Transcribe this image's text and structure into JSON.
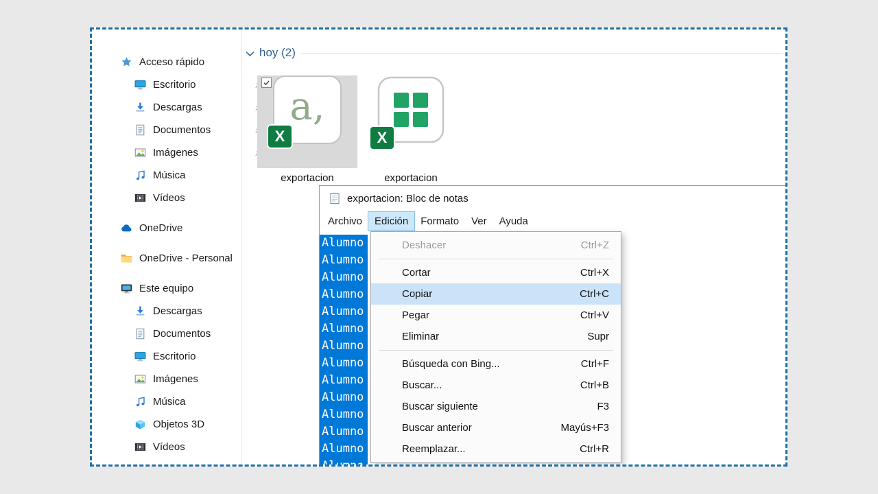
{
  "colors": {
    "marquee_dash": "#1d6fa3",
    "text_selection": "#0078d7",
    "menu_highlight": "#cbe3f9",
    "excel_green": "#107c41"
  },
  "explorer": {
    "group_header": "hoy (2)",
    "sidebar": {
      "sections": [
        {
          "label": "Acceso rápido",
          "icon": "quick-access-star-icon",
          "children": [
            {
              "label": "Escritorio",
              "icon": "desktop-icon",
              "pinned": true
            },
            {
              "label": "Descargas",
              "icon": "downloads-icon",
              "pinned": true
            },
            {
              "label": "Documentos",
              "icon": "documents-icon",
              "pinned": true
            },
            {
              "label": "Imágenes",
              "icon": "pictures-icon",
              "pinned": true
            },
            {
              "label": "Música",
              "icon": "music-icon",
              "pinned": false
            },
            {
              "label": "Vídeos",
              "icon": "videos-icon",
              "pinned": false
            }
          ]
        },
        {
          "label": "OneDrive",
          "icon": "onedrive-cloud-icon",
          "children": []
        },
        {
          "label": "OneDrive - Personal",
          "icon": "folder-icon",
          "children": []
        },
        {
          "label": "Este equipo",
          "icon": "this-pc-icon",
          "children": [
            {
              "label": "Descargas",
              "icon": "downloads-icon",
              "pinned": false
            },
            {
              "label": "Documentos",
              "icon": "documents-icon",
              "pinned": false
            },
            {
              "label": "Escritorio",
              "icon": "desktop-icon",
              "pinned": false
            },
            {
              "label": "Imágenes",
              "icon": "pictures-icon",
              "pinned": false
            },
            {
              "label": "Música",
              "icon": "music-icon",
              "pinned": false
            },
            {
              "label": "Objetos 3D",
              "icon": "3d-objects-icon",
              "pinned": false
            },
            {
              "label": "Vídeos",
              "icon": "videos-icon",
              "pinned": false
            }
          ]
        }
      ]
    },
    "files": [
      {
        "name": "exportacion",
        "selected": true,
        "checked": true,
        "icon": "csv-file-icon",
        "icon_glyph": "a,",
        "badge_glyph": "X"
      },
      {
        "name": "exportacion",
        "selected": false,
        "icon": "excel-file-icon",
        "badge_glyph": "X"
      }
    ]
  },
  "notepad": {
    "title": "exportacion: Bloc de notas",
    "menubar": [
      "Archivo",
      "Edición",
      "Formato",
      "Ver",
      "Ayuda"
    ],
    "active_menu": "Edición",
    "selection": {
      "text": "Alumno",
      "count": 14
    },
    "edit_menu": [
      {
        "label": "Deshacer",
        "shortcut": "Ctrl+Z",
        "disabled": true
      },
      {
        "separator": true
      },
      {
        "label": "Cortar",
        "shortcut": "Ctrl+X"
      },
      {
        "label": "Copiar",
        "shortcut": "Ctrl+C",
        "highlighted": true
      },
      {
        "label": "Pegar",
        "shortcut": "Ctrl+V"
      },
      {
        "label": "Eliminar",
        "shortcut": "Supr"
      },
      {
        "separator": true
      },
      {
        "label": "Búsqueda con Bing...",
        "shortcut": "Ctrl+F"
      },
      {
        "label": "Buscar...",
        "shortcut": "Ctrl+B"
      },
      {
        "label": "Buscar siguiente",
        "shortcut": "F3"
      },
      {
        "label": "Buscar anterior",
        "shortcut": "Mayús+F3"
      },
      {
        "label": "Reemplazar...",
        "shortcut": "Ctrl+R"
      }
    ]
  }
}
